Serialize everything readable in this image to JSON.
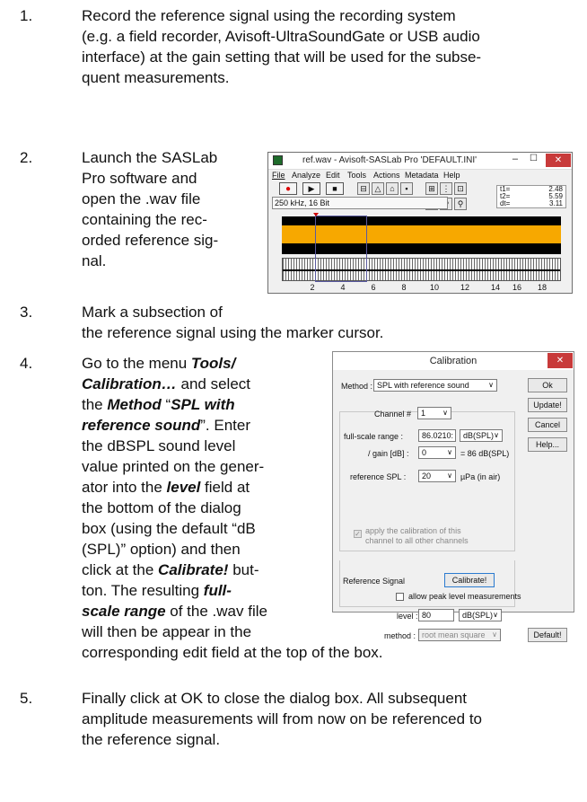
{
  "steps": [
    {
      "num": "1.",
      "text_lines": [
        "Record the reference signal using the recording system",
        "(e.g. a field recorder, Avisoft-UltraSoundGate or USB audio",
        "interface) at the gain setting that will be used for the subse-",
        "quent measurements."
      ]
    },
    {
      "num": "2.",
      "text_lines": [
        "Launch the SASLab",
        "Pro software and",
        "open the .wav file",
        "containing the rec-",
        "orded reference sig-",
        "nal."
      ]
    },
    {
      "num": "3.",
      "text_lines": [
        "Mark a subsection of",
        "the reference signal using the marker cursor."
      ]
    },
    {
      "num": "4.",
      "text_parts": {
        "l1_a": "Go to the menu ",
        "l1_b": "Tools/",
        "l2_a": "Calibration…",
        "l2_b": " and select",
        "l3_a": "the ",
        "l3_b": "Method",
        "l3_c": " “",
        "l3_d": "SPL with",
        "l4_a": "reference sound",
        "l4_b": "”. Enter",
        "l5": "the dBSPL sound level",
        "l6": "value printed on the gener-",
        "l7": "ator into the ",
        "l7_b": "level",
        "l7_c": " field at",
        "l8": "the bottom of the dialog",
        "l9": "box (using the default “dB",
        "l10": "(SPL)” option) and then",
        "l11_a": "click at the ",
        "l11_b": "Calibrate!",
        "l11_c": " but-",
        "l12_a": "ton. The resulting ",
        "l12_b": "full-",
        "l13_a": "scale range",
        "l13_b": " of the .wav file",
        "l14": "will then be appear in the",
        "l15": "corresponding edit field at the top of the box."
      }
    },
    {
      "num": "5.",
      "text_lines": [
        "Finally click at OK to close the dialog box. All subsequent",
        "amplitude measurements will from now on be referenced to",
        "the reference signal."
      ]
    }
  ],
  "saslab_window": {
    "title": "ref.wav - Avisoft-SASLab Pro  'DEFAULT.INI'",
    "menu": [
      "File",
      "Analyze",
      "Edit",
      "Tools",
      "Actions",
      "Metadata",
      "Help"
    ],
    "format": "250 kHz, 16 Bit",
    "readout": [
      {
        "k": "t1=",
        "v": "2.48"
      },
      {
        "k": "t2=",
        "v": "5.59"
      },
      {
        "k": "dt=",
        "v": "3.11"
      }
    ],
    "axis_ticks": [
      "2",
      "4",
      "6",
      "8",
      "10",
      "12",
      "14",
      "16",
      "18"
    ],
    "colors": {
      "waveform": "#f7a800",
      "background": "#000000",
      "close": "#c83a3a"
    }
  },
  "calibration_dialog": {
    "title": "Calibration",
    "method_label": "Method :",
    "method_value": "SPL with reference sound",
    "channel_label": "Channel #",
    "channel_value": "1",
    "fullscale_label": "full-scale range :",
    "fullscale_value": "86.0210:",
    "fullscale_unit": "dB(SPL)",
    "gain_label": "/ gain [dB] :",
    "gain_value": "0",
    "gain_result": "= 86 dB(SPL)",
    "refspl_label": "reference SPL :",
    "refspl_value": "20",
    "refspl_unit": "µPa  (in air)",
    "apply_line1": "apply the calibration of this",
    "apply_line2": "channel to all other channels",
    "ref_group": "Reference Signal",
    "calibrate_btn": "Calibrate!",
    "allow_peak": "allow peak level measurements",
    "level_label": "level :",
    "level_value": "80",
    "level_unit": "dB(SPL)",
    "method2_label": "method :",
    "method2_value": "root mean square",
    "ok_btn": "Ok",
    "update_btn": "Update!",
    "cancel_btn": "Cancel",
    "help_btn": "Help...",
    "default_btn": "Default!"
  }
}
